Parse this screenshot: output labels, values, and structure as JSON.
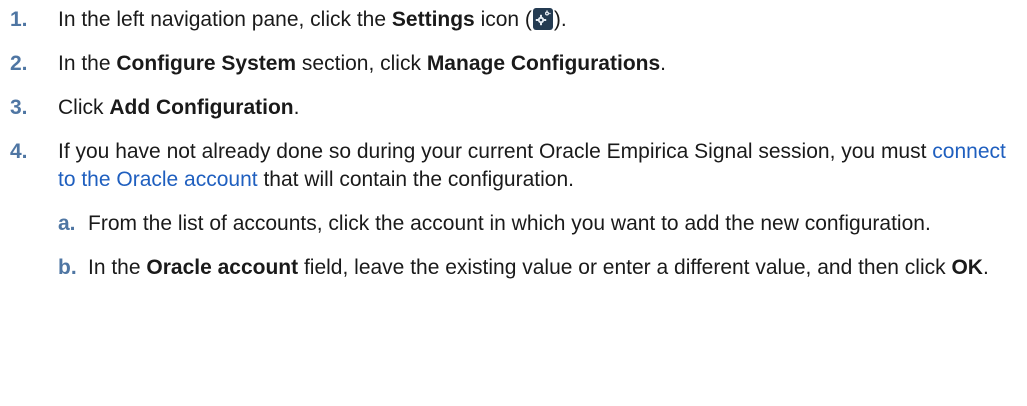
{
  "steps": [
    {
      "num": "1.",
      "parts": [
        "In the left navigation pane, click the ",
        "Settings",
        " icon (",
        ")."
      ]
    },
    {
      "num": "2.",
      "parts": [
        "In the ",
        "Configure System",
        " section, click ",
        "Manage Configurations",
        "."
      ]
    },
    {
      "num": "3.",
      "parts": [
        "Click ",
        "Add Configuration",
        "."
      ]
    },
    {
      "num": "4.",
      "parts": [
        "If you have not already done so during your current Oracle Empirica Signal session, you must ",
        "connect to the Oracle account",
        " that will contain the configuration."
      ],
      "substeps": [
        {
          "num": "a.",
          "text": "From the list of accounts, click the account in which you want to add the new configuration."
        },
        {
          "num": "b.",
          "parts": [
            "In the ",
            "Oracle account",
            " field, leave the existing value or enter a different value, and then click ",
            "OK",
            "."
          ]
        }
      ]
    }
  ],
  "icons": {
    "settings": "gear-icon"
  },
  "colors": {
    "step_number": "#4f76a3",
    "link": "#1f5fbf",
    "icon_bg": "#243b52"
  }
}
